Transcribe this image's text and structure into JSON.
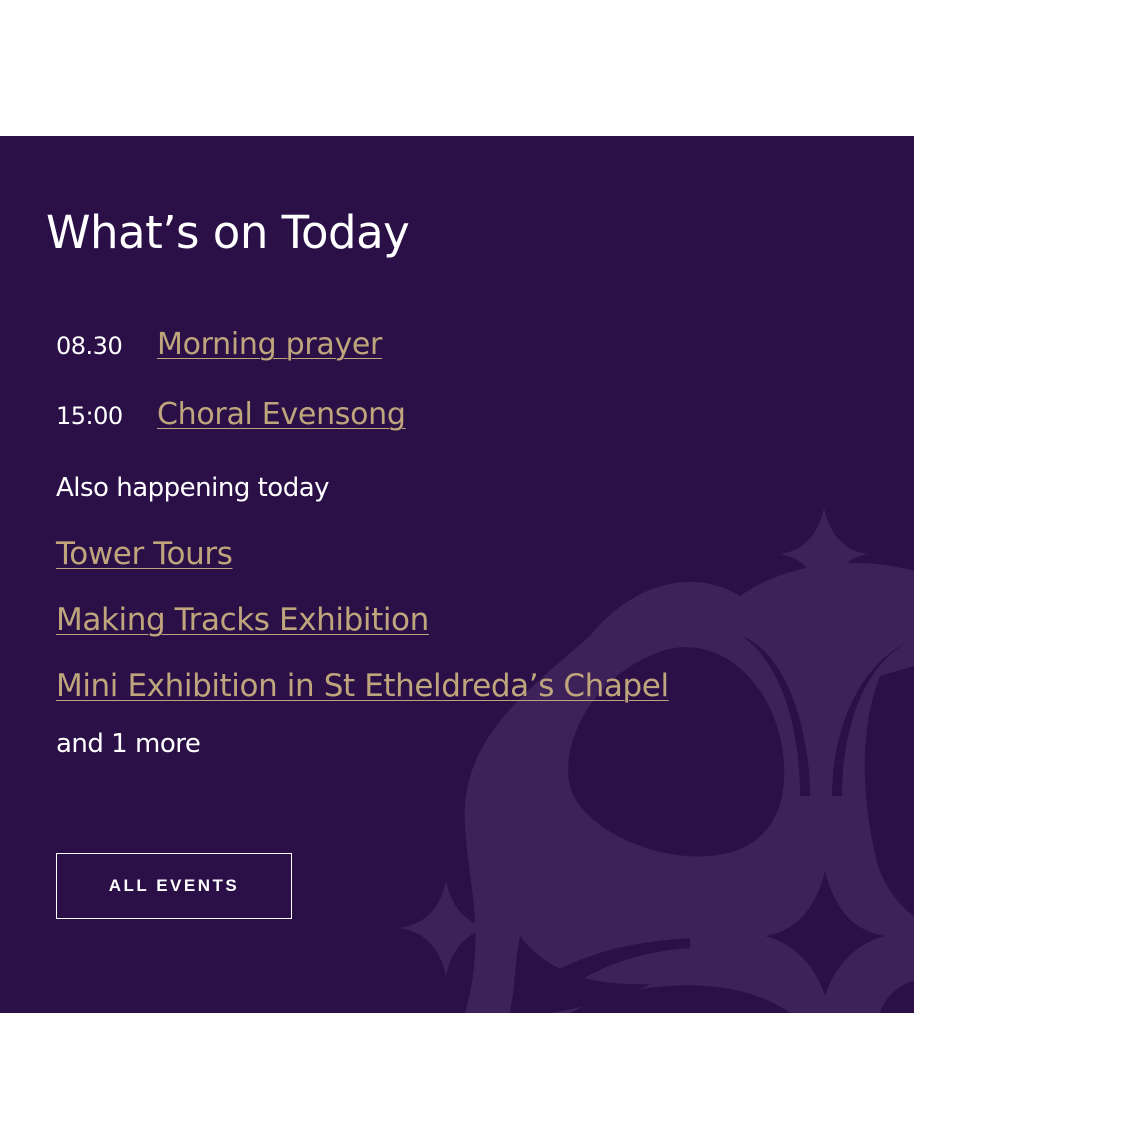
{
  "widget": {
    "title": "What’s on Today",
    "events": [
      {
        "time": "08.30",
        "label": "Morning prayer"
      },
      {
        "time": "15:00",
        "label": "Choral Evensong"
      }
    ],
    "also_label": "Also happening today",
    "also_items": [
      "Tower Tours",
      "Making Tracks Exhibition",
      "Mini Exhibition in St Etheldreda’s Chapel"
    ],
    "more_text": "and 1 more",
    "button_label": "ALL EVENTS",
    "watermark_icon": "fleur-de-lis-icon"
  },
  "colors": {
    "background": "#2b1048",
    "watermark": "#3d2159",
    "link": "#bfa57c",
    "text": "#ffffff",
    "page": "#ffffff"
  }
}
